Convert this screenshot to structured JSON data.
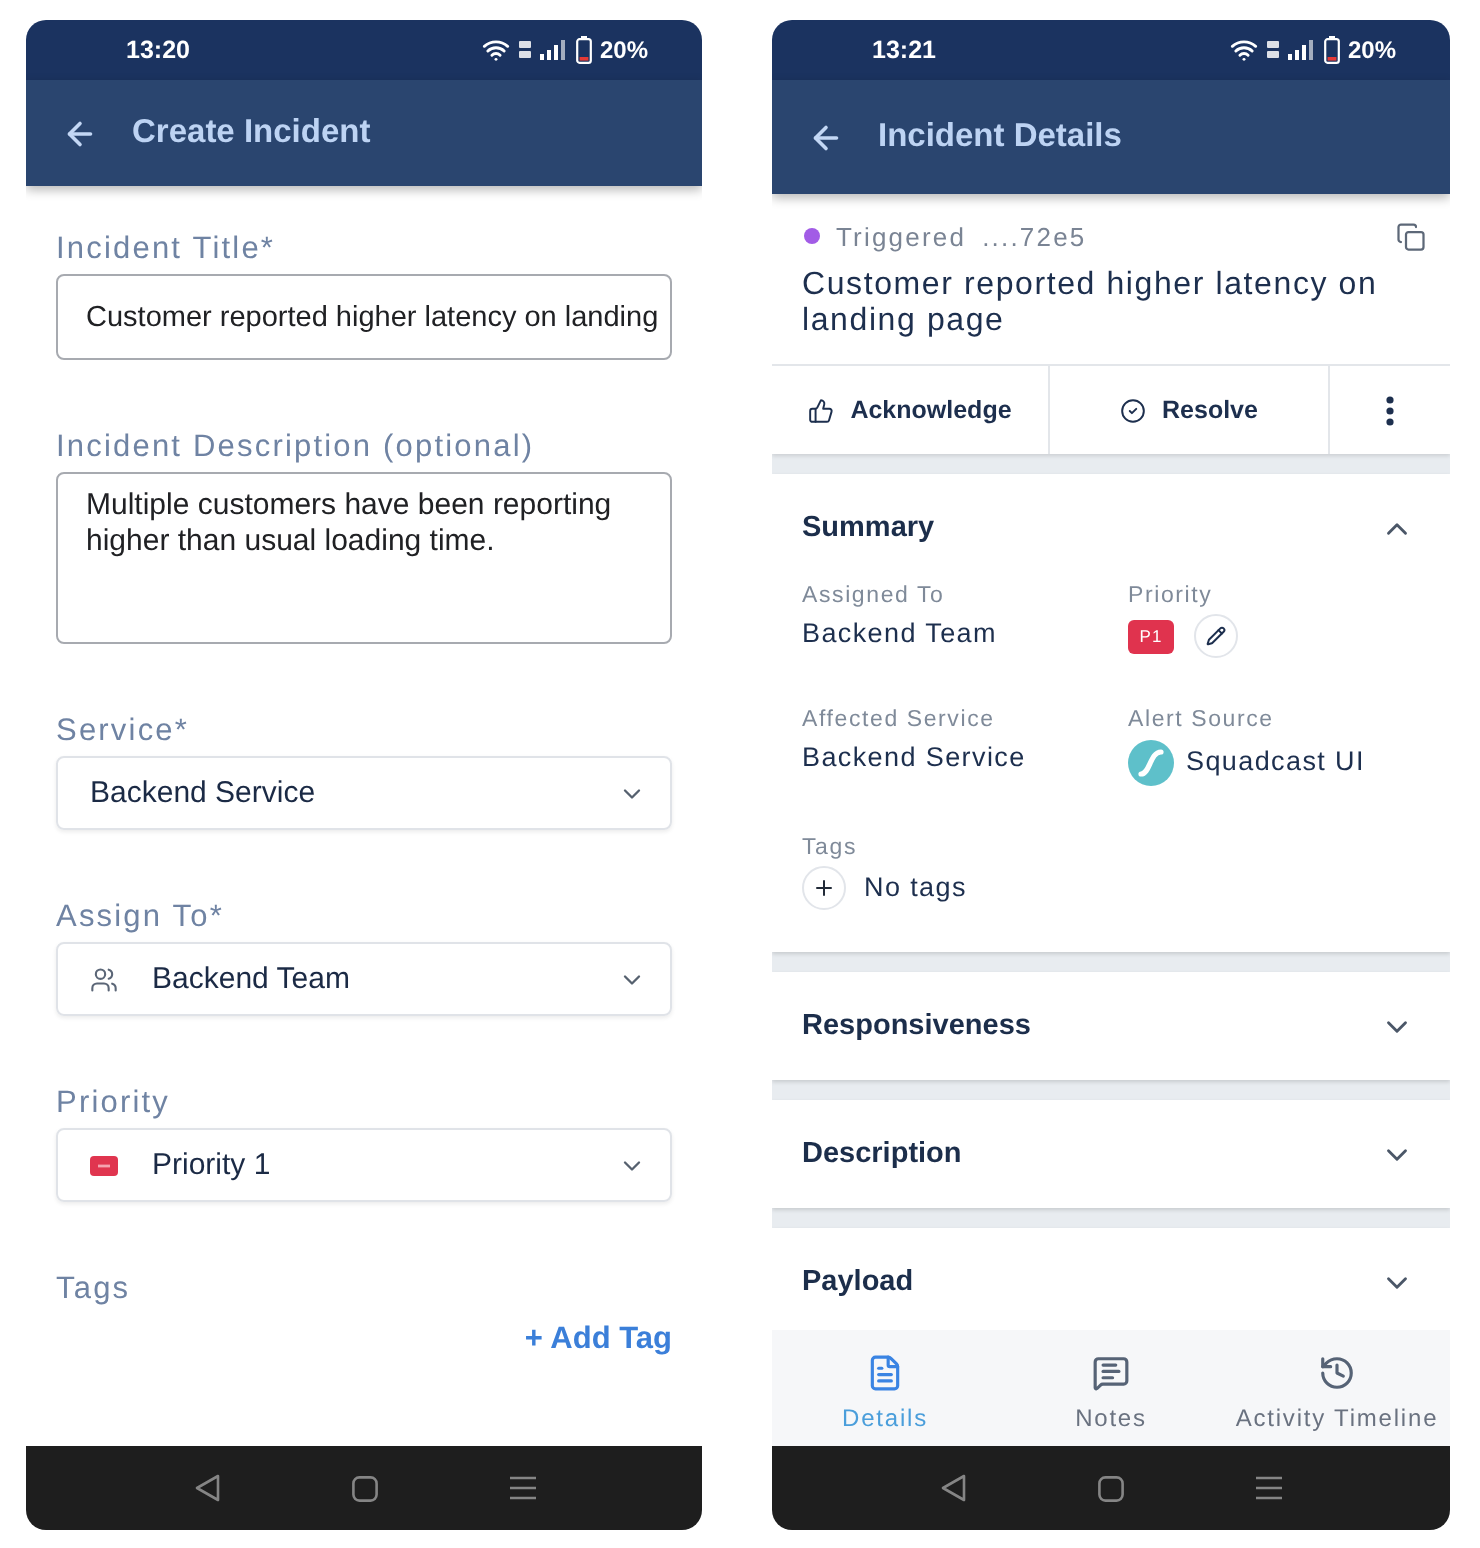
{
  "create_incident": {
    "status_bar": {
      "time": "13:20",
      "battery": "20%"
    },
    "app_bar": {
      "title": "Create Incident"
    },
    "fields": [
      {
        "kind": "text",
        "label": "Incident Title*",
        "value": "Customer reported higher latency on landing"
      },
      {
        "kind": "textarea",
        "label": "Incident Description (optional)",
        "value": "Multiple customers have been reporting higher than usual loading time."
      },
      {
        "kind": "select",
        "label": "Service*",
        "value": "Backend Service"
      },
      {
        "kind": "assignee",
        "label": "Assign To*",
        "value": "Backend Team"
      },
      {
        "kind": "priority",
        "label": "Priority",
        "value": "Priority 1"
      }
    ],
    "tags": {
      "label": "Tags",
      "add_button": "+ Add Tag"
    }
  },
  "incident_details": {
    "status_bar": {
      "time": "13:21",
      "battery": "20%"
    },
    "app_bar": {
      "title": "Incident Details"
    },
    "incident": {
      "status": "Triggered",
      "id": "....72e5",
      "title": "Customer reported higher latency on landing page"
    },
    "actions": [
      {
        "kind": "acknowledge",
        "label": "Acknowledge"
      },
      {
        "kind": "resolve",
        "label": "Resolve"
      },
      {
        "kind": "more"
      }
    ],
    "sections": [
      {
        "title": "Summary",
        "expanded": true,
        "fields": [
          {
            "kind": "text",
            "label": "Assigned To",
            "value": "Backend Team"
          },
          {
            "kind": "priority",
            "label": "Priority",
            "value": "P1"
          },
          {
            "kind": "text",
            "label": "Affected Service",
            "value": "Backend Service"
          },
          {
            "kind": "source",
            "label": "Alert Source",
            "value": "Squadcast UI"
          },
          {
            "kind": "tags",
            "label": "Tags",
            "value": "No tags"
          }
        ]
      },
      {
        "title": "Responsiveness",
        "expanded": false
      },
      {
        "title": "Description",
        "expanded": false
      },
      {
        "title": "Payload",
        "expanded": false
      }
    ],
    "tabs": [
      {
        "kind": "details",
        "label": "Details",
        "selected": true
      },
      {
        "kind": "notes",
        "label": "Notes",
        "selected": false
      },
      {
        "kind": "timeline",
        "label": "Activity Timeline",
        "selected": false
      }
    ]
  }
}
